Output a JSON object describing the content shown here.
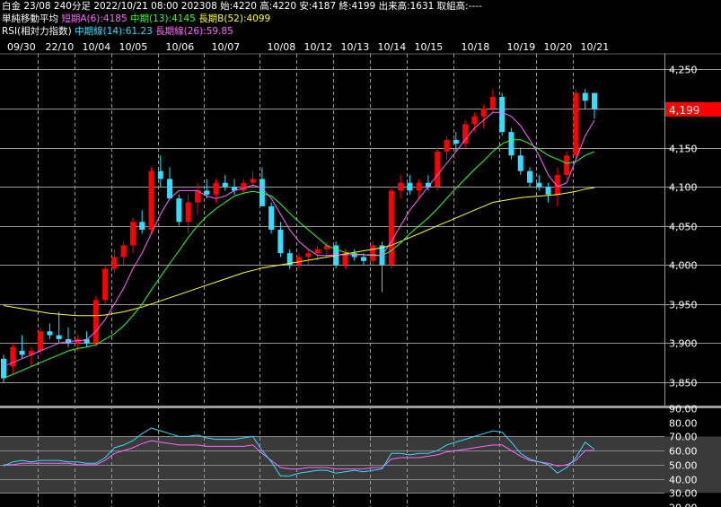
{
  "header": {
    "line1": "白金 23/08 240分足 2022/10/21 08:00 202308 始:4220 高:4220 安:4187 終:4199 出来高:1631 取組高:----",
    "ma_title": "単純移動平均",
    "ma_short": "短期A(6):4185",
    "ma_mid": "中期(13):4145",
    "ma_long": "長期B(52):4099",
    "rsi_title": "RSI(相対力指数)",
    "rsi_mid": "中期線(14):61.23",
    "rsi_long": "長期線(26):59.85"
  },
  "colors": {
    "up": "#ff0000",
    "down": "#33ddff",
    "ma_short": "#ff66ff",
    "ma_mid": "#33ff33",
    "ma_long": "#ffff33",
    "rsi14": "#33ddff",
    "rsi26": "#ff66ff",
    "price_badge": "#ff0000"
  },
  "chart_data": [
    {
      "type": "candlestick",
      "title": "白金 23/08 240分足",
      "date_labels": [
        "09/30",
        "22/10",
        "10/04",
        "10/05",
        "10/06",
        "10/07",
        "10/08",
        "10/12",
        "10/13",
        "10/14",
        "10/15",
        "10/18",
        "10/19",
        "10/20",
        "10/21"
      ],
      "y_ticks": [
        "4,250",
        "4,200",
        "4,150",
        "4,100",
        "4,050",
        "4,000",
        "3,950",
        "3,900",
        "3,850"
      ],
      "ylim": [
        3820,
        4270
      ],
      "last_price": 4199,
      "last_price_label": "4,199",
      "candles": [
        [
          3880,
          3885,
          3850,
          3855
        ],
        [
          3870,
          3900,
          3860,
          3895
        ],
        [
          3890,
          3910,
          3880,
          3885
        ],
        [
          3885,
          3895,
          3870,
          3890
        ],
        [
          3890,
          3920,
          3885,
          3915
        ],
        [
          3915,
          3925,
          3905,
          3910
        ],
        [
          3910,
          3940,
          3900,
          3905
        ],
        [
          3905,
          3920,
          3895,
          3900
        ],
        [
          3900,
          3910,
          3890,
          3905
        ],
        [
          3905,
          3915,
          3895,
          3900
        ],
        [
          3900,
          3960,
          3895,
          3955
        ],
        [
          3955,
          4000,
          3950,
          3995
        ],
        [
          3995,
          4020,
          3990,
          4010
        ],
        [
          4010,
          4030,
          4000,
          4025
        ],
        [
          4025,
          4060,
          4015,
          4055
        ],
        [
          4055,
          4070,
          4040,
          4045
        ],
        [
          4045,
          4125,
          4040,
          4120
        ],
        [
          4120,
          4140,
          4100,
          4110
        ],
        [
          4110,
          4125,
          4090,
          4085
        ],
        [
          4085,
          4090,
          4050,
          4055
        ],
        [
          4055,
          4090,
          4040,
          4080
        ],
        [
          4080,
          4105,
          4065,
          4095
        ],
        [
          4095,
          4110,
          4085,
          4090
        ],
        [
          4090,
          4110,
          4080,
          4105
        ],
        [
          4105,
          4115,
          4095,
          4100
        ],
        [
          4100,
          4110,
          4090,
          4095
        ],
        [
          4095,
          4110,
          4090,
          4105
        ],
        [
          4105,
          4120,
          4100,
          4110
        ],
        [
          4110,
          4125,
          4080,
          4075
        ],
        [
          4075,
          4080,
          4040,
          4045
        ],
        [
          4045,
          4055,
          4010,
          4015
        ],
        [
          4015,
          4020,
          3995,
          4000
        ],
        [
          4000,
          4015,
          3995,
          4010
        ],
        [
          4010,
          4020,
          4000,
          4015
        ],
        [
          4015,
          4025,
          4005,
          4020
        ],
        [
          4020,
          4030,
          4010,
          4025
        ],
        [
          4025,
          4030,
          3995,
          4000
        ],
        [
          4000,
          4020,
          3995,
          4015
        ],
        [
          4015,
          4020,
          4005,
          4010
        ],
        [
          4010,
          4015,
          4000,
          4005
        ],
        [
          4005,
          4030,
          4000,
          4025
        ],
        [
          4025,
          4030,
          3965,
          4000
        ],
        [
          4000,
          4100,
          3995,
          4095
        ],
        [
          4095,
          4115,
          4085,
          4105
        ],
        [
          4105,
          4115,
          4090,
          4095
        ],
        [
          4095,
          4110,
          4085,
          4105
        ],
        [
          4105,
          4115,
          4095,
          4100
        ],
        [
          4100,
          4150,
          4095,
          4145
        ],
        [
          4145,
          4165,
          4135,
          4160
        ],
        [
          4160,
          4170,
          4145,
          4155
        ],
        [
          4155,
          4185,
          4150,
          4180
        ],
        [
          4180,
          4195,
          4170,
          4190
        ],
        [
          4190,
          4205,
          4175,
          4200
        ],
        [
          4200,
          4225,
          4195,
          4215
        ],
        [
          4215,
          4220,
          4165,
          4170
        ],
        [
          4170,
          4175,
          4135,
          4140
        ],
        [
          4140,
          4150,
          4115,
          4120
        ],
        [
          4120,
          4125,
          4100,
          4105
        ],
        [
          4105,
          4115,
          4095,
          4100
        ],
        [
          4100,
          4105,
          4080,
          4090
        ],
        [
          4090,
          4125,
          4075,
          4115
        ],
        [
          4115,
          4145,
          4110,
          4140
        ],
        [
          4140,
          4225,
          4135,
          4220
        ],
        [
          4220,
          4225,
          4200,
          4210
        ],
        [
          4220,
          4220,
          4187,
          4199
        ]
      ],
      "ma6": [
        3870,
        3875,
        3880,
        3885,
        3890,
        3895,
        3900,
        3902,
        3903,
        3904,
        3915,
        3930,
        3950,
        3970,
        3995,
        4015,
        4040,
        4065,
        4085,
        4095,
        4095,
        4095,
        4088,
        4085,
        4088,
        4095,
        4098,
        4102,
        4098,
        4085,
        4065,
        4045,
        4030,
        4020,
        4012,
        4012,
        4013,
        4013,
        4013,
        4013,
        4012,
        4012,
        4030,
        4050,
        4070,
        4085,
        4100,
        4115,
        4130,
        4145,
        4160,
        4175,
        4185,
        4195,
        4195,
        4190,
        4178,
        4160,
        4140,
        4115,
        4100,
        4105,
        4135,
        4165,
        4185
      ],
      "ma13": [
        3855,
        3860,
        3865,
        3870,
        3875,
        3880,
        3885,
        3890,
        3893,
        3895,
        3898,
        3905,
        3912,
        3922,
        3935,
        3950,
        3968,
        3985,
        4002,
        4018,
        4035,
        4050,
        4062,
        4072,
        4080,
        4088,
        4092,
        4094,
        4092,
        4088,
        4078,
        4066,
        4055,
        4045,
        4035,
        4025,
        4020,
        4016,
        4014,
        4013,
        4013,
        4012,
        4018,
        4028,
        4040,
        4050,
        4060,
        4072,
        4085,
        4098,
        4110,
        4122,
        4133,
        4145,
        4155,
        4160,
        4160,
        4155,
        4148,
        4140,
        4135,
        4130,
        4132,
        4140,
        4145
      ],
      "ma52": [
        3948,
        3946,
        3944,
        3942,
        3940,
        3938,
        3937,
        3936,
        3935,
        3935,
        3935,
        3936,
        3938,
        3940,
        3943,
        3946,
        3950,
        3954,
        3958,
        3962,
        3966,
        3970,
        3974,
        3978,
        3982,
        3986,
        3990,
        3993,
        3996,
        3998,
        4000,
        4002,
        4004,
        4006,
        4008,
        4010,
        4012,
        4014,
        4016,
        4018,
        4020,
        4022,
        4025,
        4030,
        4035,
        4040,
        4045,
        4050,
        4055,
        4060,
        4065,
        4070,
        4075,
        4080,
        4082,
        4084,
        4086,
        4087,
        4088,
        4089,
        4090,
        4092,
        4094,
        4097,
        4099
      ]
    },
    {
      "type": "line",
      "title": "RSI(相対力指数)",
      "y_ticks": [
        "90.00",
        "80.00",
        "70.00",
        "60.00",
        "50.00",
        "40.00",
        "30.00",
        "20.00"
      ],
      "ylim": [
        20,
        90
      ],
      "series": [
        {
          "name": "中期線(14)",
          "values": [
            49,
            52,
            53,
            52,
            53,
            53,
            53,
            52,
            52,
            51,
            51,
            55,
            62,
            64,
            67,
            72,
            76,
            74,
            72,
            70,
            70,
            71,
            69,
            68,
            68,
            68,
            69,
            70,
            60,
            52,
            42,
            42,
            44,
            45,
            46,
            46,
            44,
            45,
            46,
            45,
            46,
            47,
            58,
            58,
            57,
            58,
            58,
            60,
            64,
            66,
            68,
            70,
            72,
            74,
            73,
            66,
            58,
            54,
            52,
            50,
            44,
            48,
            55,
            66,
            61
          ]
        },
        {
          "name": "長期線(26)",
          "values": [
            50,
            50,
            51,
            51,
            51,
            51,
            51,
            51,
            50,
            50,
            50,
            53,
            58,
            60,
            62,
            65,
            67,
            66,
            65,
            64,
            64,
            64,
            63,
            63,
            63,
            63,
            63,
            64,
            58,
            53,
            48,
            47,
            47,
            48,
            48,
            48,
            47,
            47,
            47,
            47,
            48,
            48,
            54,
            55,
            55,
            55,
            56,
            57,
            59,
            60,
            61,
            62,
            63,
            64,
            64,
            60,
            56,
            53,
            52,
            51,
            49,
            50,
            53,
            60,
            60
          ]
        }
      ]
    }
  ]
}
